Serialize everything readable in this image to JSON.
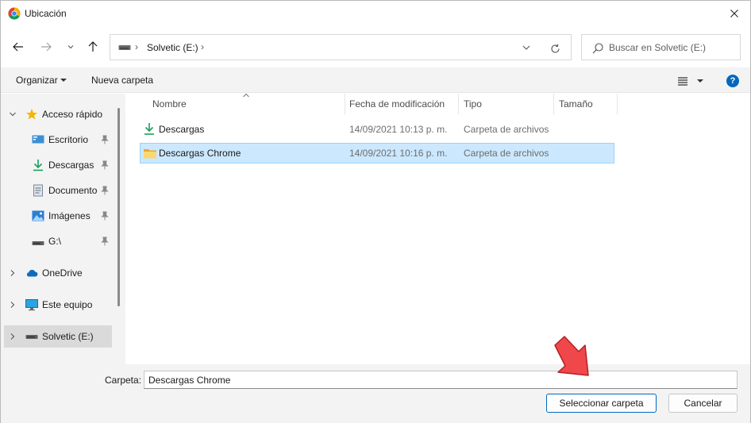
{
  "window": {
    "title": "Ubicación",
    "title_icon": "chrome-icon",
    "close_icon": "close-icon"
  },
  "navigation": {
    "back_icon": "arrow-left-icon",
    "forward_icon": "arrow-right-icon",
    "recent_icon": "chevron-down-icon",
    "up_icon": "arrow-up-icon"
  },
  "address": {
    "drive_icon": "drive-icon",
    "path": "Solvetic (E:)",
    "separator": "›"
  },
  "search": {
    "placeholder": "Buscar en Solvetic (E:)"
  },
  "toolbar": {
    "organize_label": "Organizar",
    "new_folder_label": "Nueva carpeta",
    "view_icon": "view-details-icon",
    "help_label": "?"
  },
  "sidebar": {
    "items": [
      {
        "label": "Acceso rápido",
        "icon": "star-icon",
        "expanded": true
      },
      {
        "label": "Escritorio",
        "icon": "desktop-icon",
        "pinned": true
      },
      {
        "label": "Descargas",
        "icon": "download-icon",
        "pinned": true
      },
      {
        "label": "Documento",
        "icon": "document-icon",
        "pinned": true
      },
      {
        "label": "Imágenes",
        "icon": "pictures-icon",
        "pinned": true
      },
      {
        "label": "G:\\",
        "icon": "drive-icon",
        "pinned": true
      },
      {
        "label": "OneDrive",
        "icon": "cloud-icon",
        "expanded": false
      },
      {
        "label": "Este equipo",
        "icon": "computer-icon",
        "expanded": false
      },
      {
        "label": "Solvetic (E:)",
        "icon": "drive-icon",
        "expanded": false,
        "selected": true
      }
    ]
  },
  "files": {
    "columns": [
      "Nombre",
      "Fecha de modificación",
      "Tipo",
      "Tamaño"
    ],
    "rows": [
      {
        "name": "Descargas",
        "modified": "14/09/2021 10:13 p. m.",
        "type": "Carpeta de archivos",
        "size": "",
        "icon": "download-folder-icon",
        "selected": false
      },
      {
        "name": "Descargas Chrome",
        "modified": "14/09/2021 10:16 p. m.",
        "type": "Carpeta de archivos",
        "size": "",
        "icon": "folder-icon",
        "selected": true
      }
    ]
  },
  "footer": {
    "folder_label": "Carpeta:",
    "folder_value": "Descargas Chrome",
    "select_button": "Seleccionar carpeta",
    "cancel_button": "Cancelar"
  },
  "colors": {
    "accent": "#0067c0",
    "selection": "#cce8ff",
    "annotation_arrow": "#f0484a"
  }
}
